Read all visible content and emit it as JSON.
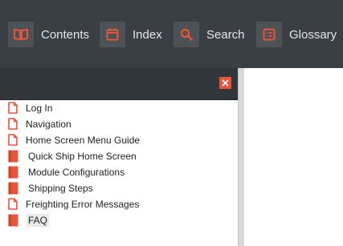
{
  "toolbar": {
    "contents": "Contents",
    "index": "Index",
    "search": "Search",
    "glossary": "Glossary"
  },
  "icons": {
    "contents": "book-open-icon",
    "index": "calendar-icon",
    "search": "search-icon",
    "glossary": "list-icon",
    "close": "close-icon",
    "page": "page-icon",
    "book": "book-icon"
  },
  "colors": {
    "toolbar_bg": "#3a3f44",
    "accent": "#e8553a",
    "text": "#222222"
  },
  "toc": {
    "items": [
      {
        "label": "Log In",
        "type": "page"
      },
      {
        "label": "Navigation",
        "type": "page"
      },
      {
        "label": "Home Screen Menu Guide",
        "type": "page"
      },
      {
        "label": "Quick Ship Home Screen",
        "type": "book"
      },
      {
        "label": "Module Configurations",
        "type": "book"
      },
      {
        "label": "Shipping Steps",
        "type": "book"
      },
      {
        "label": "Freighting Error Messages",
        "type": "page"
      },
      {
        "label": "FAQ",
        "type": "book",
        "selected": true
      }
    ]
  }
}
